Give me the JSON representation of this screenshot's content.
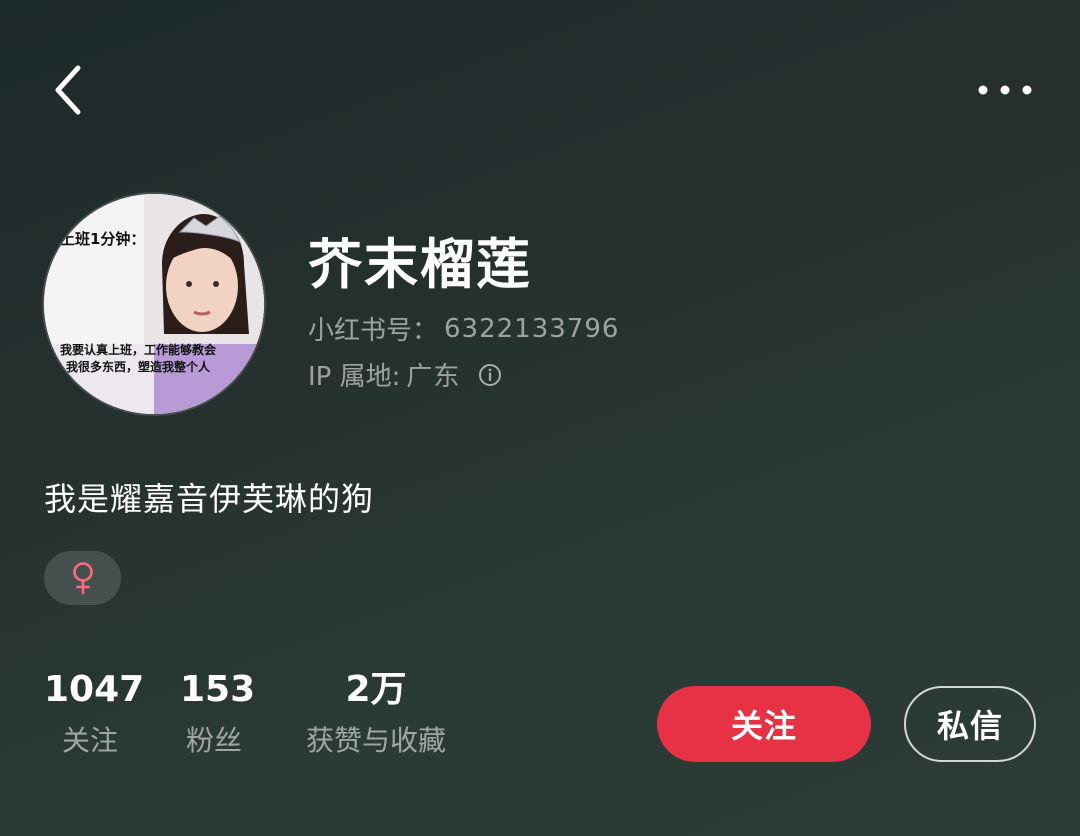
{
  "header": {
    "back_icon": "chevron-left-icon",
    "more_icon": "more-horizontal-icon"
  },
  "profile": {
    "avatar_caption_top": "上班1分钟：",
    "avatar_caption_line1": "我要认真上班，工作能够教会",
    "avatar_caption_line2": "我很多东西，塑造我整个人",
    "nickname": "芥末榴莲",
    "id_label": "小红书号：",
    "id_value": "6322133796",
    "ip_label": "IP 属地:",
    "ip_value": "广东",
    "bio": "我是耀嘉音伊芙琳的狗",
    "gender_symbol": "♀",
    "gender_color": "#ff6b7d"
  },
  "stats": {
    "following_count": "1047",
    "following_label": "关注",
    "followers_count": "153",
    "followers_label": "粉丝",
    "likes_count": "2万",
    "likes_label": "获赞与收藏"
  },
  "actions": {
    "follow_label": "关注",
    "follow_color": "#e63244",
    "message_label": "私信"
  }
}
